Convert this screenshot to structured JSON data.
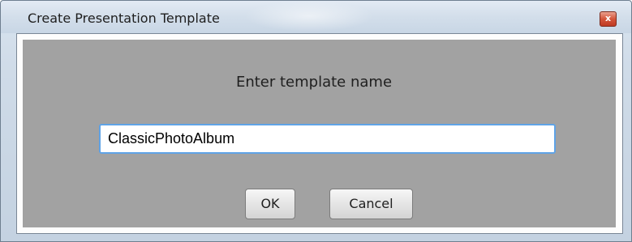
{
  "window": {
    "title": "Create Presentation Template",
    "close_glyph": "x",
    "close_icon": "close-icon",
    "accent_close": "#d4553b"
  },
  "dialog": {
    "prompt": "Enter template name",
    "template_name_value": "ClassicPhotoAlbum",
    "ok_label": "OK",
    "cancel_label": "Cancel",
    "background_color": "#a2a2a2",
    "input_focus_color": "#5fa3e6"
  }
}
